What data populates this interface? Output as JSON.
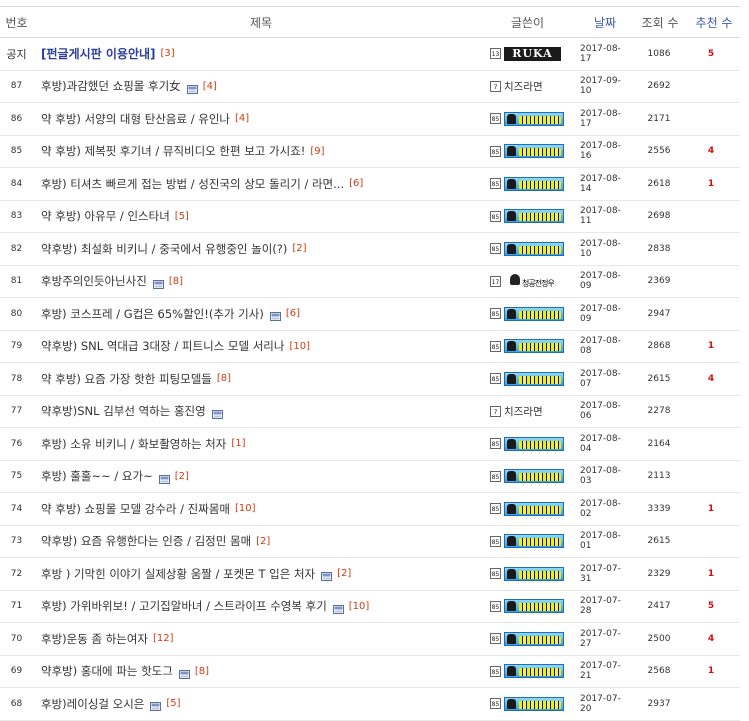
{
  "header": {
    "no": "번호",
    "title": "제목",
    "writer": "글쓴이",
    "date": "날짜",
    "views": "조회 수",
    "rec": "추천 수"
  },
  "colors": {
    "header_blue": "#3b5ab6",
    "comment_count": "#d23b14",
    "recommend": "#d01010",
    "notice_title": "#2a3f9c"
  },
  "rows": [
    {
      "no": "공지",
      "title": "[펀글게시판 이용안내]",
      "comments": "[3]",
      "img": false,
      "writer_type": "ruka",
      "writer_text": "RUKA",
      "level": "13",
      "date": "2017-08-17",
      "views": "1086",
      "rec": "5",
      "notice": true
    },
    {
      "no": "87",
      "title": "후방)과감했던 쇼핑몰 후기女",
      "comments": "[4]",
      "img": true,
      "writer_type": "text",
      "writer_text": "치즈라면",
      "level": "7",
      "date": "2017-09-10",
      "views": "2692",
      "rec": ""
    },
    {
      "no": "86",
      "title": "약 후방) 서양의 대형 탄산음료 / 유인나",
      "comments": "[4]",
      "img": false,
      "writer_type": "nick",
      "writer_text": "",
      "level": "85",
      "date": "2017-08-17",
      "views": "2171",
      "rec": ""
    },
    {
      "no": "85",
      "title": "약 후방) 제복핏 후기녀 / 뮤직비디오 한편 보고 가시죠!",
      "comments": "[9]",
      "img": false,
      "writer_type": "nick",
      "writer_text": "",
      "level": "85",
      "date": "2017-08-16",
      "views": "2556",
      "rec": "4"
    },
    {
      "no": "84",
      "title": "후방) 티셔츠 빠르게 접는 방법 / 성진국의 상모 돌리기 / 라면...",
      "comments": "[6]",
      "img": false,
      "writer_type": "nick",
      "writer_text": "",
      "level": "85",
      "date": "2017-08-14",
      "views": "2618",
      "rec": "1"
    },
    {
      "no": "83",
      "title": "약 후방) 아유무 / 인스타녀",
      "comments": "[5]",
      "img": false,
      "writer_type": "nick",
      "writer_text": "",
      "level": "85",
      "date": "2017-08-11",
      "views": "2698",
      "rec": ""
    },
    {
      "no": "82",
      "title": "약후방) 최설화 비키니 / 중국에서 유행중인 놀이(?)",
      "comments": "[2]",
      "img": false,
      "writer_type": "nick",
      "writer_text": "",
      "level": "85",
      "date": "2017-08-10",
      "views": "2838",
      "rec": ""
    },
    {
      "no": "81",
      "title": "후방주의인듯아닌사진",
      "comments": "[8]",
      "img": true,
      "writer_type": "mini",
      "writer_text": "청공전정우",
      "level": "17",
      "date": "2017-08-09",
      "views": "2369",
      "rec": ""
    },
    {
      "no": "80",
      "title": "후방) 코스프레 / G컵은 65%할인!(추가 기사)",
      "comments": "[6]",
      "img": true,
      "writer_type": "nick",
      "writer_text": "",
      "level": "85",
      "date": "2017-08-09",
      "views": "2947",
      "rec": ""
    },
    {
      "no": "79",
      "title": "약후방) SNL 역대급 3대장 / 피트니스 모델 서리나",
      "comments": "[10]",
      "img": false,
      "writer_type": "nick",
      "writer_text": "",
      "level": "85",
      "date": "2017-08-08",
      "views": "2868",
      "rec": "1"
    },
    {
      "no": "78",
      "title": "약 후방) 요즘 가장 핫한 피팅모델들",
      "comments": "[8]",
      "img": false,
      "writer_type": "nick",
      "writer_text": "",
      "level": "85",
      "date": "2017-08-07",
      "views": "2615",
      "rec": "4"
    },
    {
      "no": "77",
      "title": "약후방)SNL 김부선 역하는 홍진영",
      "comments": "",
      "img": true,
      "writer_type": "text",
      "writer_text": "치즈라면",
      "level": "7",
      "date": "2017-08-06",
      "views": "2278",
      "rec": ""
    },
    {
      "no": "76",
      "title": "후방) 소유 비키니 / 화보촬영하는 처자",
      "comments": "[1]",
      "img": false,
      "writer_type": "nick",
      "writer_text": "",
      "level": "85",
      "date": "2017-08-04",
      "views": "2164",
      "rec": ""
    },
    {
      "no": "75",
      "title": "후방) 훌훌~~ / 요가~",
      "comments": "[2]",
      "img": true,
      "writer_type": "nick",
      "writer_text": "",
      "level": "85",
      "date": "2017-08-03",
      "views": "2113",
      "rec": ""
    },
    {
      "no": "74",
      "title": "약 후방) 쇼핑몰 모델 강수라 / 진짜몸매",
      "comments": "[10]",
      "img": false,
      "writer_type": "nick",
      "writer_text": "",
      "level": "85",
      "date": "2017-08-02",
      "views": "3339",
      "rec": "1"
    },
    {
      "no": "73",
      "title": "약후방) 요즘 유행한다는 인증 / 김정민 몸매",
      "comments": "[2]",
      "img": false,
      "writer_type": "nick",
      "writer_text": "",
      "level": "85",
      "date": "2017-08-01",
      "views": "2615",
      "rec": ""
    },
    {
      "no": "72",
      "title": "후방 ) 기막힌 이야기 실제상황 움짤 / 포켓몬 T 입은 처자",
      "comments": "[2]",
      "img": true,
      "writer_type": "nick",
      "writer_text": "",
      "level": "85",
      "date": "2017-07-31",
      "views": "2329",
      "rec": "1"
    },
    {
      "no": "71",
      "title": "후방) 가위바위보! / 고기집알바녀 / 스트라이프 수영복 후기",
      "comments": "[10]",
      "img": true,
      "writer_type": "nick",
      "writer_text": "",
      "level": "85",
      "date": "2017-07-28",
      "views": "2417",
      "rec": "5"
    },
    {
      "no": "70",
      "title": "후방)운동 좀 하는여자",
      "comments": "[12]",
      "img": false,
      "writer_type": "nick",
      "writer_text": "",
      "level": "85",
      "date": "2017-07-27",
      "views": "2500",
      "rec": "4"
    },
    {
      "no": "69",
      "title": "약후방) 홍대에 파는 핫도그",
      "comments": "[8]",
      "img": true,
      "writer_type": "nick",
      "writer_text": "",
      "level": "85",
      "date": "2017-07-21",
      "views": "2568",
      "rec": "1"
    },
    {
      "no": "68",
      "title": "후방)레이싱걸 오시은",
      "comments": "[5]",
      "img": true,
      "writer_type": "nick",
      "writer_text": "",
      "level": "85",
      "date": "2017-07-20",
      "views": "2937",
      "rec": ""
    }
  ]
}
